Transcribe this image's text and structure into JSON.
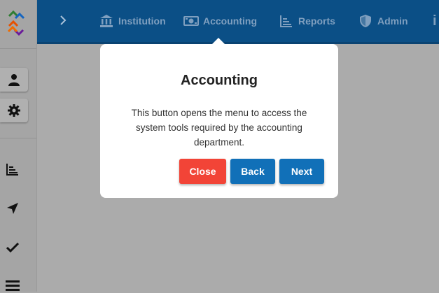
{
  "topbar": {
    "nav": [
      {
        "label": "Institution",
        "icon": "bank-icon"
      },
      {
        "label": "Accounting",
        "icon": "money-icon"
      },
      {
        "label": "Reports",
        "icon": "chart-icon"
      },
      {
        "label": "Admin",
        "icon": "shield-icon"
      },
      {
        "label": "i",
        "icon": "info-icon"
      }
    ]
  },
  "popover": {
    "title": "Accounting",
    "body": "This button opens the menu to access the system tools required by the accounting department.",
    "close_label": "Close",
    "back_label": "Back",
    "next_label": "Next"
  },
  "colors": {
    "topbar": "#0b4f86",
    "close_button": "#f24437",
    "back_button": "#1170b8",
    "next_button": "#1170b8",
    "nav_text": "#7f9fbf"
  }
}
